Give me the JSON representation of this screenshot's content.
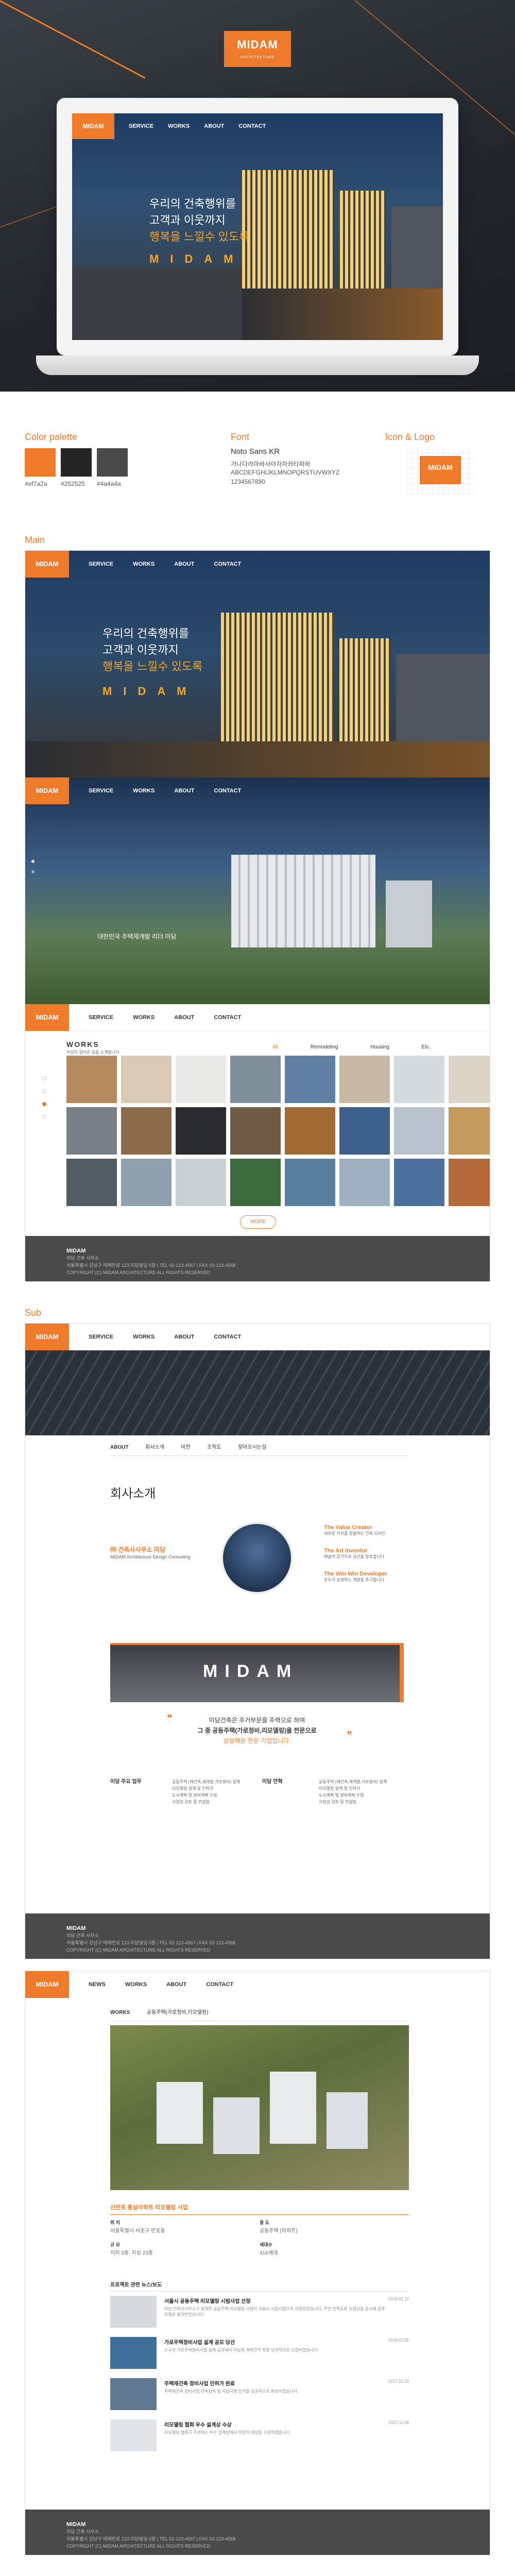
{
  "brand": {
    "logo": "MIDAM",
    "tagline": "ARCHITECTURE",
    "accent": "#ef7a2a"
  },
  "nav": {
    "service": "SERVICE",
    "works": "WORKS",
    "about": "ABOUT",
    "contact": "CONTACT",
    "news": "NEWS"
  },
  "hero": {
    "line1": "우리의 건축행위를",
    "line2": "고객과 이웃까지",
    "line3": "행복을 느낄수 있도록",
    "word": "MIDAM"
  },
  "palette": {
    "label": "Color palette",
    "colors": [
      {
        "hex": "#ef7a2a",
        "label": "#ef7a2a"
      },
      {
        "hex": "#252525",
        "label": "#252525"
      },
      {
        "hex": "#4a4a4a",
        "label": "#4a4a4a"
      }
    ]
  },
  "font": {
    "label": "Font",
    "name": "Noto Sans KR",
    "hangul": "가나다라마바사아자차카타파하",
    "latin": "ABCDEFGHIJKLMNOPQRSTUVWXYZ",
    "digits": "1234567890"
  },
  "iconlogo": {
    "label": "Icon & Logo"
  },
  "main": {
    "label": "Main",
    "caption": "대한민국 주택재개발 리더 미담",
    "works_title": "WORKS",
    "works_sub": "미담이 걸어온 길을 소개합니다",
    "filters": [
      "All",
      "Remodeling",
      "Housing",
      "Etc."
    ],
    "more": "MORE"
  },
  "footer": {
    "brand": "MIDAM",
    "lines": [
      "미담 건축 사무소",
      "서울특별시 강남구 테헤란로 123 미담빌딩 5층 | TEL 02-123-4567 | FAX 02-123-4568",
      "COPYRIGHT (C) MIDAM ARCHITECTURE ALL RIGHTS RESERVED"
    ]
  },
  "sub": {
    "label": "Sub",
    "tabs": [
      "ABOUT",
      "회사소개",
      "비전",
      "조직도",
      "찾아오시는길"
    ],
    "title": "회사소개",
    "company": "㈜ 건축사사무소 미담",
    "company_en": "MIDAM Architecture Design Consulting",
    "values": [
      {
        "h": "The Value Creator",
        "d": "새로운 가치를 창출하는 건축 디자인"
      },
      {
        "h": "The Art Inventor",
        "d": "예술적 감각으로 공간을 창조합니다"
      },
      {
        "h": "The Win-Win Developer",
        "d": "모두가 상생하는 개발을 추구합니다"
      }
    ],
    "quote_line1": "미담건축은 주거부문을 주력으로 하며",
    "quote_line2": "그 중 공동주택(가로정비,리모델링)을 전문으로",
    "quote_line3": "성장해온 전문 기업입니다.",
    "col1_title": "미담 주요 업무",
    "col2_title": "미담 연혁",
    "col_lines": [
      "공동주택 (재건축,재개발,가로정비) 설계",
      "리모델링 설계 및 인허가",
      "도시계획 및 정비계획 수립",
      "사업성 검토 및 컨설팅"
    ]
  },
  "works_sub": {
    "tabs": [
      "WORKS",
      "공동주택(가로정비,리모델링)"
    ],
    "project_title": "신반포 홍실아파트 리모델링 사업",
    "details": [
      {
        "k": "위 치",
        "v": "서울특별시 서초구 반포동"
      },
      {
        "k": "용 도",
        "v": "공동주택 (아파트)"
      },
      {
        "k": "규 모",
        "v": "지하 3층, 지상 23층"
      },
      {
        "k": "세대수",
        "v": "416세대"
      }
    ],
    "list_title": "프로젝트 관련 뉴스/보도",
    "news": [
      {
        "t": "서울시 공동주택 리모델링 시범사업 선정",
        "d": "미담 건축사사무소가 설계한 공동주택 리모델링 사업이 서울시 시범사업으로 선정되었습니다. 주민 만족도와 사업성을 동시에 갖춘 모델로 평가받았습니다.",
        "dt": "2018.03.12"
      },
      {
        "t": "가로주택정비사업 설계 공모 당선",
        "d": "소규모 가로주택정비사업 설계 공모에서 미담의 계획안이 최종 당선작으로 선정되었습니다.",
        "dt": "2018.02.05"
      },
      {
        "t": "주택재건축 정비사업 인허가 완료",
        "d": "주택재건축 정비사업 건축심의 및 사업시행 인가를 성공적으로 완료하였습니다.",
        "dt": "2017.12.20"
      },
      {
        "t": "리모델링 협회 우수 설계상 수상",
        "d": "리모델링 협회가 주관하는 우수 설계상에서 미담이 대상을 수상하였습니다.",
        "dt": "2017.11.08"
      }
    ]
  }
}
